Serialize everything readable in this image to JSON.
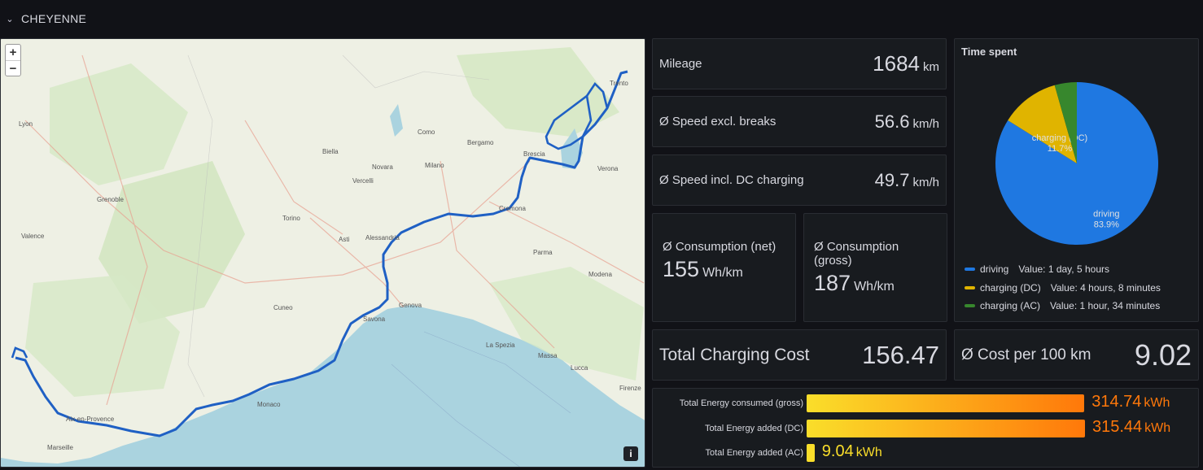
{
  "row": {
    "title": "CHEYENNE",
    "chevron_icon": "chevron-down-icon"
  },
  "map": {
    "zoom_in": "+",
    "zoom_out": "−",
    "info_button": "i",
    "cities": [
      "Lyon",
      "Grenoble",
      "Valence",
      "Torino",
      "Milano",
      "Novara",
      "Biella",
      "Brescia",
      "Verona",
      "Genova",
      "Cuneo",
      "Alessandria",
      "Parma",
      "Modena",
      "La Spezia",
      "Firenze",
      "Monaco",
      "Marseille",
      "Aix-en-Provence",
      "Cremona",
      "Vercelli",
      "Asti",
      "Massa",
      "Lucca",
      "Savona",
      "Trento",
      "Bergamo",
      "Como"
    ]
  },
  "stats": {
    "mileage": {
      "label": "Mileage",
      "value": "1684",
      "unit": "km"
    },
    "speed_excl": {
      "label": "Ø Speed excl. breaks",
      "value": "56.6",
      "unit": "km/h"
    },
    "speed_incl": {
      "label": "Ø Speed incl. DC charging",
      "value": "49.7",
      "unit": "km/h"
    },
    "cons_net": {
      "label": "Ø Consumption (net)",
      "value": "155",
      "unit": "Wh/km"
    },
    "cons_gross": {
      "label": "Ø Consumption (gross)",
      "value": "187",
      "unit": "Wh/km"
    },
    "charging_cost": {
      "label": "Total Charging Cost",
      "value": "156.47"
    },
    "cost_per_100": {
      "label": "Ø Cost per 100 km",
      "value": "9.02"
    }
  },
  "time_spent": {
    "title": "Time spent",
    "slices": [
      {
        "name": "driving",
        "percent": 83.9,
        "percent_label": "83.9%",
        "value": "Value: 1 day, 5 hours",
        "color": "#1f78e1"
      },
      {
        "name": "charging (DC)",
        "percent": 11.7,
        "percent_label": "11.7%",
        "value": "Value: 4 hours, 8 minutes",
        "color": "#e0b400"
      },
      {
        "name": "charging (AC)",
        "percent": 4.4,
        "percent_label": "",
        "value": "Value: 1 hour, 34 minutes",
        "color": "#37872d"
      }
    ]
  },
  "energy": {
    "max": 315.44,
    "rows": [
      {
        "label": "Total Energy consumed (gross)",
        "value": 314.74,
        "value_label": "314.74",
        "unit": "kWh",
        "color": "#ff780a"
      },
      {
        "label": "Total Energy added (DC)",
        "value": 315.44,
        "value_label": "315.44",
        "unit": "kWh",
        "color": "#ff780a"
      },
      {
        "label": "Total Energy added (AC)",
        "value": 9.04,
        "value_label": "9.04",
        "unit": "kWh",
        "color": "#fade2a"
      }
    ]
  }
}
